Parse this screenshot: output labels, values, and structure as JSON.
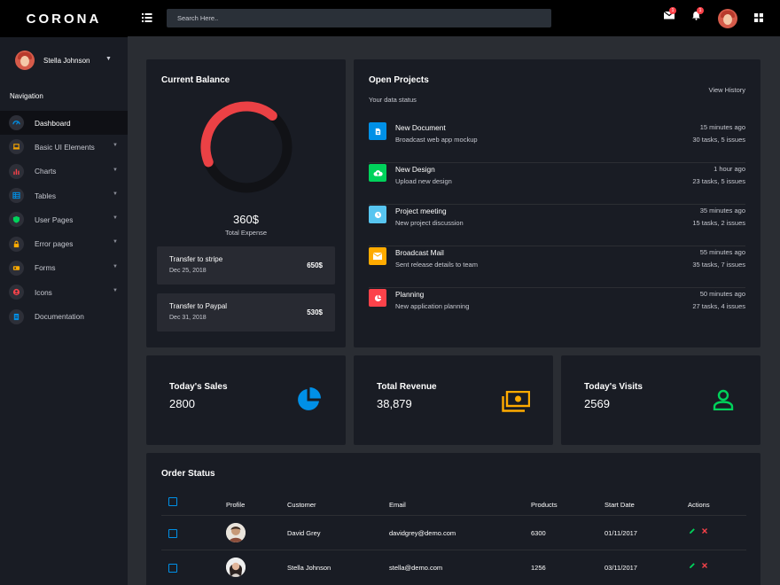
{
  "brand": "CORONA",
  "user": {
    "name": "Stella Johnson"
  },
  "nav": {
    "title": "Navigation",
    "items": [
      {
        "label": "Dashboard",
        "icon": "speedometer-icon",
        "color": "#0090e7",
        "caret": false
      },
      {
        "label": "Basic UI Elements",
        "icon": "laptop-icon",
        "color": "#ffab00",
        "caret": true
      },
      {
        "label": "Charts",
        "icon": "chart-bar-icon",
        "color": "#fc424a",
        "caret": true
      },
      {
        "label": "Tables",
        "icon": "table-icon",
        "color": "#0090e7",
        "caret": true
      },
      {
        "label": "User Pages",
        "icon": "security-icon",
        "color": "#00d25b",
        "caret": true
      },
      {
        "label": "Error pages",
        "icon": "lock-icon",
        "color": "#ffab00",
        "caret": true
      },
      {
        "label": "Forms",
        "icon": "forms-icon",
        "color": "#ffab00",
        "caret": true
      },
      {
        "label": "Icons",
        "icon": "contacts-icon",
        "color": "#fc424a",
        "caret": true
      },
      {
        "label": "Documentation",
        "icon": "file-document-icon",
        "color": "#0090e7",
        "caret": false
      }
    ]
  },
  "topbar": {
    "search_placeholder": "Search Here..",
    "mail_badge": "1",
    "bell_badge": "1"
  },
  "balance": {
    "title": "Current Balance",
    "amount": "360$",
    "caption": "Total Expense",
    "progress": 0.42,
    "arc_color": "#eb4145",
    "track_color": "#111216",
    "transfers": [
      {
        "title": "Transfer to stripe",
        "date": "Dec 25, 2018",
        "amount": "650$"
      },
      {
        "title": "Transfer to Paypal",
        "date": "Dec 31, 2018",
        "amount": "530$"
      }
    ]
  },
  "projects": {
    "title": "Open Projects",
    "subtitle": "Your data status",
    "history_link": "View History",
    "items": [
      {
        "title": "New Document",
        "sub": "Broadcast web app mockup",
        "time": "15 minutes ago",
        "tasks": "30 tasks, 5 issues",
        "icon": "file-icon",
        "color": "#0090e7"
      },
      {
        "title": "New Design",
        "sub": "Upload new design",
        "time": "1 hour ago",
        "tasks": "23 tasks, 5 issues",
        "icon": "cloud-upload-icon",
        "color": "#00d25b"
      },
      {
        "title": "Project meeting",
        "sub": "New project discussion",
        "time": "35 minutes ago",
        "tasks": "15 tasks, 2 issues",
        "icon": "clock-icon",
        "color": "#8f5fe8"
      },
      {
        "title": "Broadcast Mail",
        "sub": "Sent release details to team",
        "time": "55 minutes ago",
        "tasks": "35 tasks, 7 issues",
        "icon": "email-icon",
        "color": "#ffab00"
      },
      {
        "title": "Planning",
        "sub": "New application planning",
        "time": "50 minutes ago",
        "tasks": "27 tasks, 4 issues",
        "icon": "chart-pie-icon",
        "color": "#fc424a"
      }
    ]
  },
  "stats": [
    {
      "title": "Today's Sales",
      "value": "2800",
      "icon": "chart-pie-icon",
      "color": "#0090e7"
    },
    {
      "title": "Total Revenue",
      "value": "38,879",
      "icon": "cash-multiple-icon",
      "color": "#ffab00"
    },
    {
      "title": "Today's Visits",
      "value": "2569",
      "icon": "account-icon",
      "color": "#00d25b"
    }
  ],
  "orders": {
    "title": "Order Status",
    "headers": [
      "Profile",
      "Customer",
      "Email",
      "Products",
      "Start Date",
      "Actions"
    ],
    "rows": [
      {
        "customer": "David Grey",
        "email": "davidgrey@demo.com",
        "products": "6300",
        "start": "01/11/2017"
      },
      {
        "customer": "Stella Johnson",
        "email": "stella@demo.com",
        "products": "1256",
        "start": "03/11/2017"
      }
    ]
  }
}
